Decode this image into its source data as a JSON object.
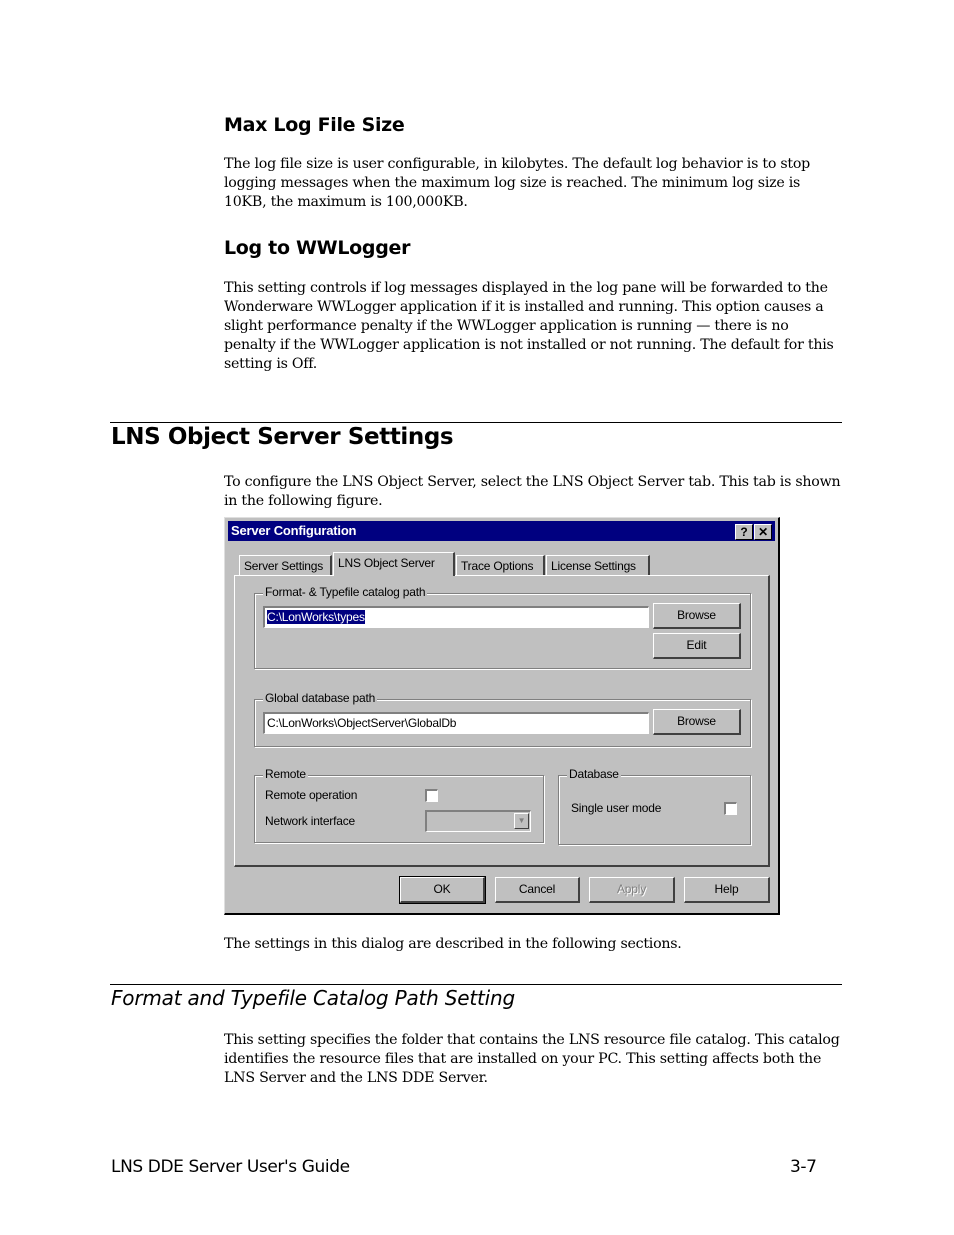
{
  "sections": {
    "max_log": {
      "heading": "Max Log File Size",
      "paragraph": "The log file size is user configurable, in kilobytes.  The default log behavior is to stop logging messages when the maximum log size is reached.  The minimum log size is 10KB, the maximum is 100,000KB."
    },
    "wwlogger": {
      "heading": "Log to WWLogger",
      "paragraph": "This setting controls if log messages displayed in the log pane will be forwarded to the Wonderware WWLogger application if it is installed and running.  This option causes a slight performance penalty if the WWLogger application is running — there is no penalty if the WWLogger application is not installed or not running. The default for this setting is Off."
    },
    "lns_object_server": {
      "heading": "LNS Object Server Settings",
      "intro": "To configure the LNS Object Server, select the LNS Object Server tab.  This tab is shown in the following figure.",
      "after_figure": "The settings in this dialog are described in the following sections."
    },
    "format_typefile": {
      "heading": "Format and Typefile Catalog Path Setting",
      "paragraph": "This setting specifies the folder that contains the LNS resource file catalog.  This catalog identifies the resource files that are installed on your PC.  This setting affects both the LNS Server and the LNS DDE Server."
    }
  },
  "dialog": {
    "title": "Server Configuration",
    "help_glyph": "?",
    "close_glyph": "✕",
    "tabs": [
      {
        "label": "Server Settings",
        "active": false
      },
      {
        "label": "LNS Object Server",
        "active": true
      },
      {
        "label": "Trace Options",
        "active": false
      },
      {
        "label": "License Settings",
        "active": false
      }
    ],
    "format_group": {
      "label": "Format- & Typefile catalog path",
      "path_value": "C:\\LonWorks\\types",
      "browse_label": "Browse",
      "edit_label": "Edit"
    },
    "global_group": {
      "label": "Global database path",
      "path_value": "C:\\LonWorks\\ObjectServer\\GlobalDb",
      "browse_label": "Browse"
    },
    "remote_group": {
      "label": "Remote",
      "remote_operation_label": "Remote operation",
      "remote_operation_checked": false,
      "network_interface_label": "Network interface",
      "network_interface_value": "",
      "dropdown_glyph": "▼"
    },
    "database_group": {
      "label": "Database",
      "single_user_label": "Single user mode",
      "single_user_checked": false
    },
    "buttons": {
      "ok": "OK",
      "cancel": "Cancel",
      "apply": "Apply",
      "help": "Help"
    }
  },
  "footer": {
    "guide_title": "LNS DDE Server User's Guide",
    "page_number": "3-7"
  }
}
